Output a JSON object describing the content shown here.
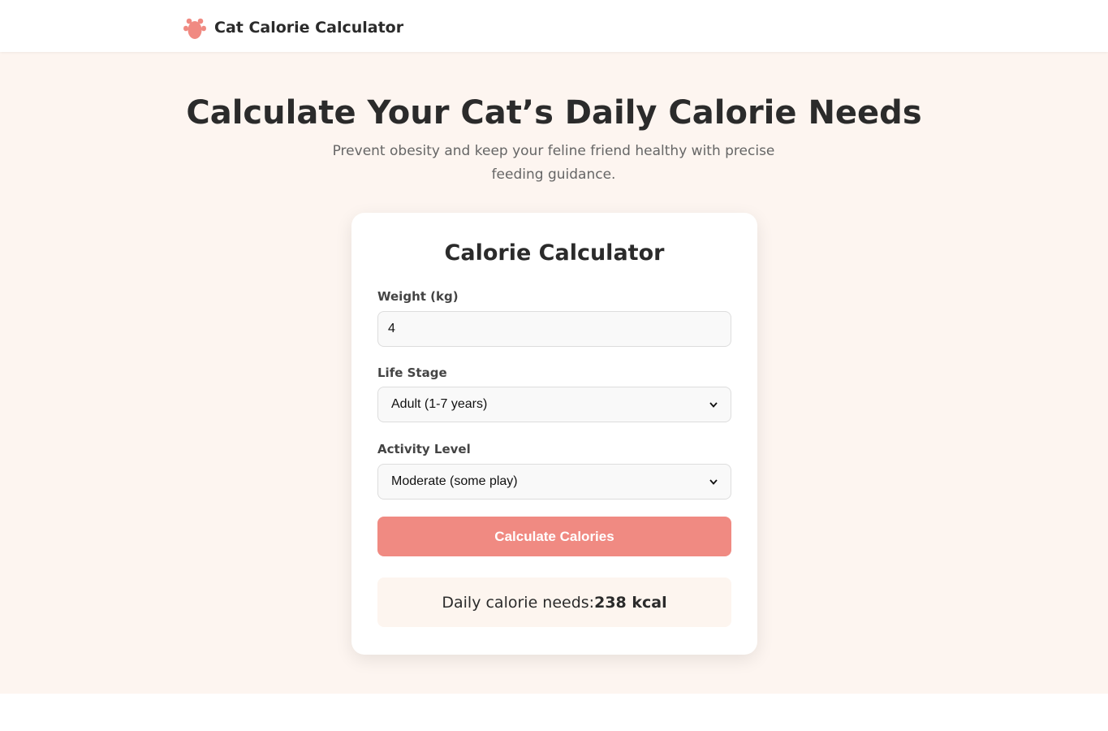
{
  "header": {
    "brand_title": "Cat Calorie Calculator",
    "brand_icon": "cat-paw-icon",
    "accent_color": "#f08a82"
  },
  "hero": {
    "title": "Calculate Your Cat’s Daily Calorie Needs",
    "subtitle": "Prevent obesity and keep your feline friend healthy with precise feeding guidance."
  },
  "calculator": {
    "title": "Calorie Calculator",
    "weight": {
      "label": "Weight (kg)",
      "value": "4"
    },
    "life_stage": {
      "label": "Life Stage",
      "selected": "Adult (1-7 years)"
    },
    "activity": {
      "label": "Activity Level",
      "selected": "Moderate (some play)"
    },
    "button_label": "Calculate Calories",
    "result": {
      "label": "Daily calorie needs:",
      "value": "238 kcal"
    }
  }
}
